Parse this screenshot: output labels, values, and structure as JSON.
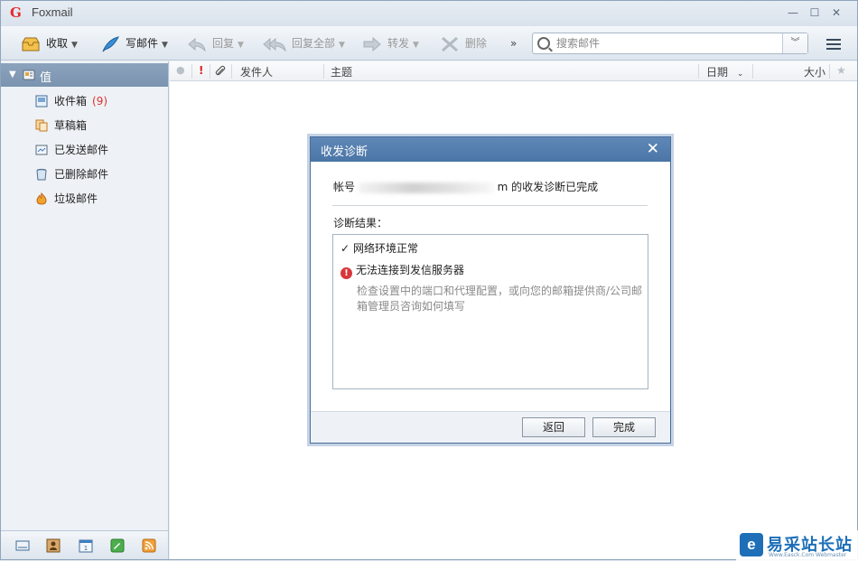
{
  "window": {
    "title": "Foxmail",
    "logo_icon": "foxmail-logo-icon",
    "controls": [
      "minimize-icon",
      "maximize-icon",
      "close-icon"
    ]
  },
  "toolbar": {
    "receive": "收取",
    "compose": "写邮件",
    "reply": "回复",
    "reply_all": "回复全部",
    "forward": "转发",
    "delete": "删除",
    "more": "»",
    "search_placeholder": "搜索邮件"
  },
  "sidebar": {
    "account": "值",
    "folders": [
      {
        "label": "收件箱",
        "count": "(9)",
        "icon": "inbox-icon"
      },
      {
        "label": "草稿箱",
        "icon": "drafts-icon"
      },
      {
        "label": "已发送邮件",
        "icon": "sent-icon"
      },
      {
        "label": "已删除邮件",
        "icon": "trash-icon"
      },
      {
        "label": "垃圾邮件",
        "icon": "spam-icon"
      }
    ],
    "bottom_icons": [
      "mail-icon",
      "contacts-icon",
      "calendar-icon",
      "notes-icon",
      "rss-icon"
    ]
  },
  "list_header": {
    "priority": "!",
    "sender": "发件人",
    "subject": "主题",
    "date": "日期",
    "size": "大小"
  },
  "dialog": {
    "title": "收发诊断",
    "message_prefix": "帐号",
    "message_suffix": "m 的收发诊断已完成",
    "result_label": "诊断结果：",
    "results": [
      {
        "status": "ok",
        "text": "网络环境正常"
      },
      {
        "status": "error",
        "text": "无法连接到发信服务器"
      }
    ],
    "error_detail": "检查设置中的端口和代理配置，或向您的邮箱提供商/公司邮箱管理员咨询如何填写",
    "buttons": {
      "back": "返回",
      "finish": "完成"
    }
  },
  "watermark": {
    "text": "易采站长站",
    "subtext": "Www.Easck.Com Webmaster"
  },
  "colors": {
    "dialog_title": "#4f7aab",
    "account_row": "#8098b3",
    "error": "#d9363a",
    "unread_count": "#e03030"
  }
}
